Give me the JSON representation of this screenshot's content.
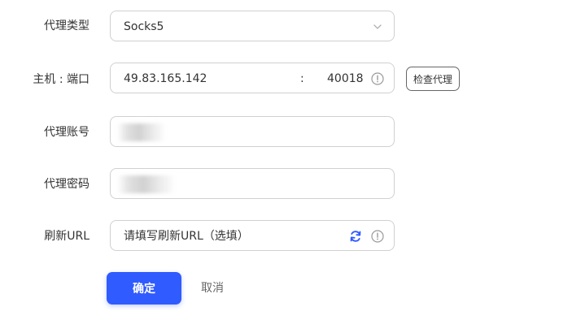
{
  "form": {
    "proxy_type": {
      "label": "代理类型",
      "value": "Socks5"
    },
    "host_port": {
      "label": "主机 : 端口",
      "host": "49.83.165.142",
      "separator": ":",
      "port": "40018"
    },
    "check_button": "检查代理",
    "proxy_account": {
      "label": "代理账号",
      "value": ""
    },
    "proxy_password": {
      "label": "代理密码",
      "value": ""
    },
    "refresh_url": {
      "label": "刷新URL",
      "placeholder": "请填写刷新URL（选填）"
    },
    "confirm_button": "确定",
    "cancel_button": "取消"
  },
  "colors": {
    "primary": "#2f5bff",
    "border": "#d0d0d0",
    "refresh_icon": "#2f5bff"
  }
}
